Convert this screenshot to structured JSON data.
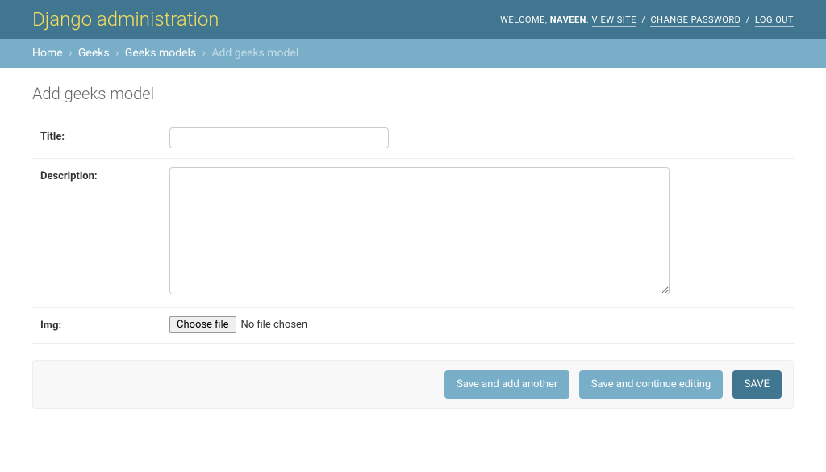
{
  "header": {
    "branding": "Django administration",
    "welcome": "WELCOME,",
    "username": "NAVEEN",
    "view_site": "VIEW SITE",
    "change_password": "CHANGE PASSWORD",
    "log_out": "LOG OUT"
  },
  "breadcrumbs": {
    "home": "Home",
    "app": "Geeks",
    "model": "Geeks models",
    "current": "Add geeks model"
  },
  "page_title": "Add geeks model",
  "fields": {
    "title_label": "Title:",
    "title_value": "",
    "description_label": "Description:",
    "description_value": "",
    "img_label": "Img:",
    "file_button": "Choose file",
    "file_status": "No file chosen"
  },
  "submit": {
    "save_add_another": "Save and add another",
    "save_continue": "Save and continue editing",
    "save": "SAVE"
  }
}
